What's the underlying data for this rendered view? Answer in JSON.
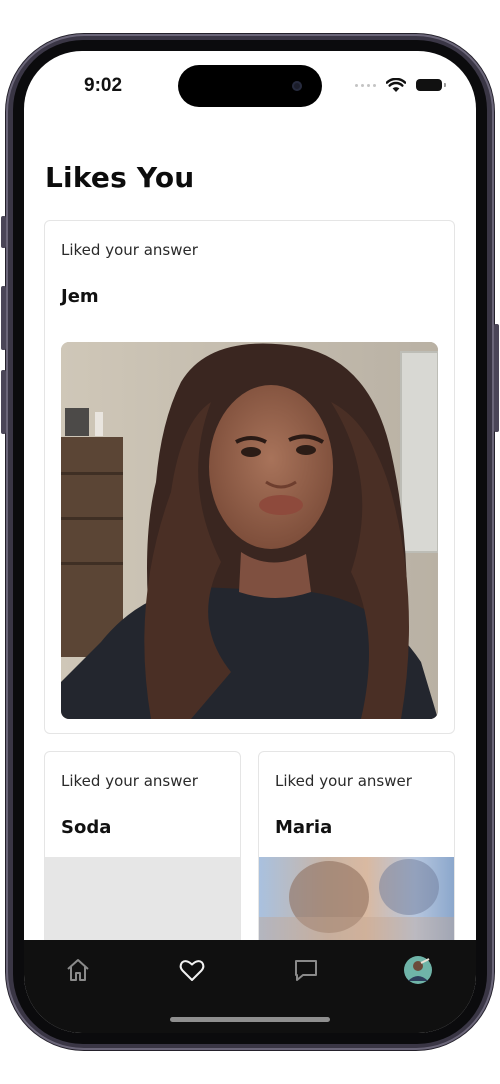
{
  "status_bar": {
    "time": "9:02"
  },
  "page": {
    "title": "Likes You"
  },
  "cards": [
    {
      "caption": "Liked your answer",
      "name": "Jem"
    },
    {
      "caption": "Liked your answer",
      "name": "Soda"
    },
    {
      "caption": "Liked your answer",
      "name": "Maria"
    }
  ],
  "tab_bar": {
    "items": [
      {
        "icon": "home-icon"
      },
      {
        "icon": "heart-icon",
        "active": true
      },
      {
        "icon": "chat-icon"
      },
      {
        "icon": "profile-avatar"
      }
    ]
  },
  "colors": {
    "tab_bar_bg": "#101010",
    "card_border": "#e5e5e5",
    "placeholder": "#e6e6e6"
  }
}
